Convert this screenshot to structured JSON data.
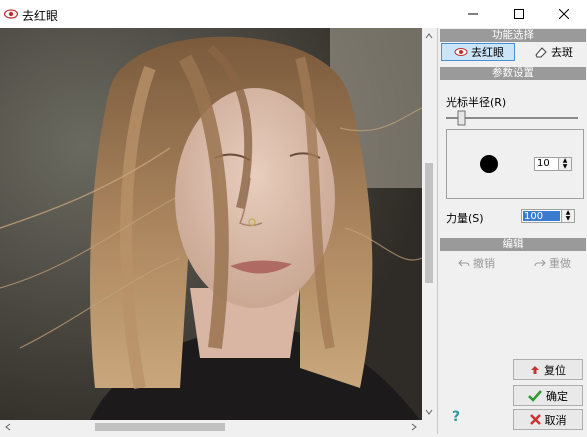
{
  "window": {
    "title": "去红眼"
  },
  "tools": {
    "header": "功能选择",
    "red_eye_label": "去红眼",
    "spot_label": "去斑"
  },
  "params": {
    "header": "参数设置",
    "cursor_radius_label": "光标半径(R)",
    "radius_value": "10",
    "strength_label": "力量(S)",
    "strength_value": "100"
  },
  "edit": {
    "header": "编辑",
    "undo_label": "撤销",
    "redo_label": "重做"
  },
  "actions": {
    "reset_label": "复位",
    "ok_label": "确定",
    "cancel_label": "取消",
    "help_label": "?"
  },
  "colors": {
    "accent": "#4a90d0",
    "ok_green": "#2e9a2e",
    "cancel_red": "#c83232",
    "header_gray": "#9a9a9a"
  }
}
